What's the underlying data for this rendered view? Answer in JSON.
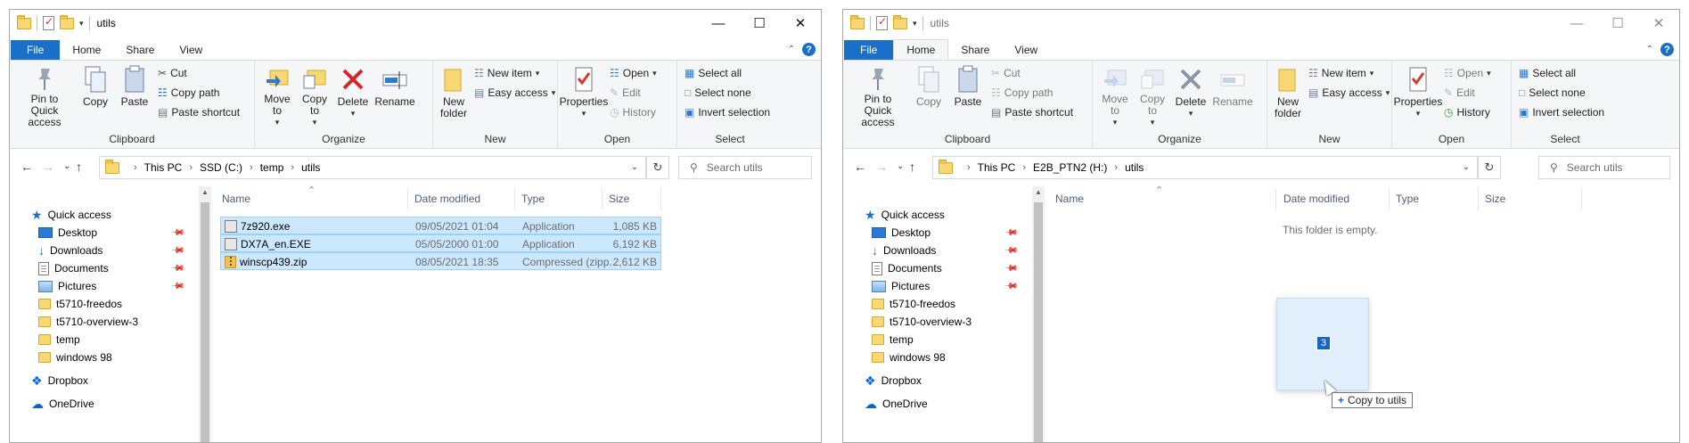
{
  "colors": {
    "accent": "#1a6fc9",
    "selection": "#cce8ff",
    "selection_border": "#99d1ff"
  },
  "left": {
    "title": "utils",
    "tabs": {
      "file": "File",
      "home": "Home",
      "share": "Share",
      "view": "View"
    },
    "ribbon": {
      "clipboard": {
        "pin": "Pin to Quick access",
        "copy": "Copy",
        "paste": "Paste",
        "cut": "Cut",
        "copy_path": "Copy path",
        "paste_shortcut": "Paste shortcut",
        "label": "Clipboard"
      },
      "organize": {
        "move_to": "Move to",
        "copy_to": "Copy to",
        "delete": "Delete",
        "rename": "Rename",
        "label": "Organize"
      },
      "new": {
        "new_folder": "New folder",
        "new_item": "New item",
        "easy_access": "Easy access",
        "label": "New"
      },
      "open": {
        "properties": "Properties",
        "open": "Open",
        "edit": "Edit",
        "history": "History",
        "label": "Open"
      },
      "select": {
        "select_all": "Select all",
        "select_none": "Select none",
        "invert": "Invert selection",
        "label": "Select"
      }
    },
    "breadcrumb": [
      "This PC",
      "SSD (C:)",
      "temp",
      "utils"
    ],
    "search_placeholder": "Search utils",
    "nav": {
      "quick_access": "Quick access",
      "items": [
        "Desktop",
        "Downloads",
        "Documents",
        "Pictures",
        "t5710-freedos",
        "t5710-overview-3",
        "temp",
        "windows 98"
      ],
      "dropbox": "Dropbox",
      "onedrive": "OneDrive"
    },
    "columns": {
      "name": "Name",
      "date": "Date modified",
      "type": "Type",
      "size": "Size"
    },
    "files": [
      {
        "name": "7z920.exe",
        "date": "09/05/2021 01:04",
        "type": "Application",
        "size": "1,085 KB"
      },
      {
        "name": "DX7A_en.EXE",
        "date": "05/05/2000 01:00",
        "type": "Application",
        "size": "6,192 KB"
      },
      {
        "name": "winscp439.zip",
        "date": "08/05/2021 18:35",
        "type": "Compressed (zipp...",
        "size": "2,612 KB"
      }
    ]
  },
  "right": {
    "title": "utils",
    "tabs": {
      "file": "File",
      "home": "Home",
      "share": "Share",
      "view": "View"
    },
    "ribbon": {
      "clipboard": {
        "pin": "Pin to Quick access",
        "copy": "Copy",
        "paste": "Paste",
        "cut": "Cut",
        "copy_path": "Copy path",
        "paste_shortcut": "Paste shortcut",
        "label": "Clipboard"
      },
      "organize": {
        "move_to": "Move to",
        "copy_to": "Copy to",
        "delete": "Delete",
        "rename": "Rename",
        "label": "Organize"
      },
      "new": {
        "new_folder": "New folder",
        "new_item": "New item",
        "easy_access": "Easy access",
        "label": "New"
      },
      "open": {
        "properties": "Properties",
        "open": "Open",
        "edit": "Edit",
        "history": "History",
        "label": "Open"
      },
      "select": {
        "select_all": "Select all",
        "select_none": "Select none",
        "invert": "Invert selection",
        "label": "Select"
      }
    },
    "breadcrumb": [
      "This PC",
      "E2B_PTN2 (H:)",
      "utils"
    ],
    "search_placeholder": "Search utils",
    "nav": {
      "quick_access": "Quick access",
      "items": [
        "Desktop",
        "Downloads",
        "Documents",
        "Pictures",
        "t5710-freedos",
        "t5710-overview-3",
        "temp",
        "windows 98"
      ],
      "dropbox": "Dropbox",
      "onedrive": "OneDrive"
    },
    "columns": {
      "name": "Name",
      "date": "Date modified",
      "type": "Type",
      "size": "Size"
    },
    "empty_message": "This folder is empty."
  },
  "drag": {
    "count": "3",
    "tooltip": "Copy to utils"
  }
}
